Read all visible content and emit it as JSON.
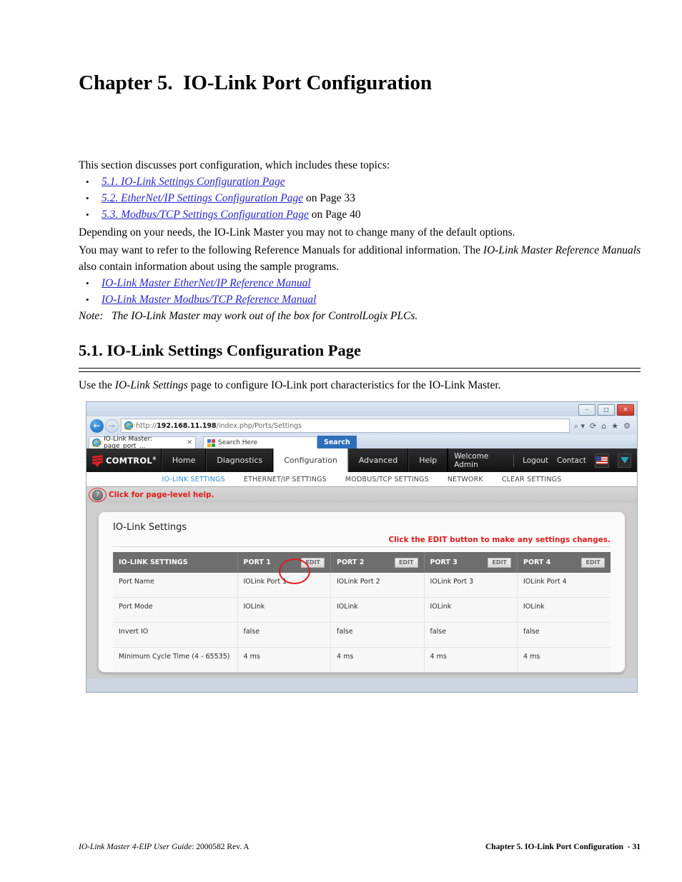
{
  "document": {
    "chapter_title": "Chapter 5.  IO-Link Port Configuration",
    "intro_line": "This section discusses port configuration, which includes these topics:",
    "topics": [
      {
        "link": "5.1. IO-Link Settings Configuration Page",
        "suffix": ""
      },
      {
        "link": "5.2. EtherNet/IP Settings Configuration Page",
        "suffix": " on Page 33"
      },
      {
        "link": "5.3. Modbus/TCP Settings Configuration Page",
        "suffix": " on Page 40"
      }
    ],
    "para_depending": "Depending on your needs, the IO-Link Master you may not to change many of the default options.",
    "para_refer_1": "You may want to refer to the following Reference Manuals for additional information. The ",
    "para_refer_italic": "IO-Link Master Reference Manuals",
    "para_refer_2": " also contain information about using the sample programs.",
    "manuals": [
      "IO-Link Master EtherNet/IP Reference Manual",
      "IO-Link Master Modbus/TCP Reference Manual"
    ],
    "note_label": "Note:",
    "note_text": "The IO-Link Master may work out of the box for ControlLogix PLCs.",
    "section_heading": "5.1. IO-Link Settings Configuration Page",
    "use_line_1": "Use the ",
    "use_line_italic": "IO-Link Settings",
    "use_line_2": " page to configure IO-Link port characteristics for the IO-Link Master.",
    "link_color": "#2626cc"
  },
  "footer": {
    "left_italic": "IO-Link Master 4-EIP User Guide",
    "left_rest": ": 2000582 Rev. A",
    "right": "Chapter 5. IO-Link Port Configuration  - 31"
  },
  "browser": {
    "window_controls": {
      "minimize": "–",
      "maximize": "□",
      "close": "✕"
    },
    "back_glyph": "←",
    "forward_glyph": "→",
    "url_scheme": "http://",
    "url_host": "192.168.11.198",
    "url_path": "/index.php/Ports/Settings",
    "toolbar_icons": {
      "search_dropdown": "⌕ ▾",
      "refresh": "⟳",
      "home": "⌂",
      "favorites": "★",
      "tools": "⚙"
    },
    "tab_title": "IO-Link Master: page_port_...",
    "tab_close": "✕",
    "search_placeholder": "Search Here",
    "search_button": "Search"
  },
  "app": {
    "logo_text": "COMTROL",
    "logo_tm": "®",
    "nav_items": [
      {
        "label": "Home",
        "active": false
      },
      {
        "label": "Diagnostics",
        "active": false
      },
      {
        "label": "Configuration",
        "active": true
      },
      {
        "label": "Advanced",
        "active": false
      },
      {
        "label": "Help",
        "active": false
      }
    ],
    "welcome": "Welcome Admin",
    "logout": "Logout",
    "contact": "Contact",
    "language_flag": "us-flag-icon",
    "subnav": [
      {
        "label": "IO-LINK SETTINGS",
        "selected": true
      },
      {
        "label": "ETHERNET/IP SETTINGS",
        "selected": false
      },
      {
        "label": "MODBUS/TCP SETTINGS",
        "selected": false
      },
      {
        "label": "NETWORK",
        "selected": false
      },
      {
        "label": "CLEAR SETTINGS",
        "selected": false
      }
    ],
    "help_icon_glyph": "?",
    "help_text": "Click for page-level help.",
    "panel_title": "IO-Link Settings",
    "edit_hint": "Click the EDIT button to make any settings changes.",
    "table": {
      "header_label": "IO-LINK SETTINGS",
      "ports": [
        "PORT 1",
        "PORT 2",
        "PORT 3",
        "PORT 4"
      ],
      "edit_label": "EDIT",
      "rows": [
        {
          "label": "Port Name",
          "values": [
            "IOLink Port 1",
            "IOLink Port 2",
            "IOLink Port 3",
            "IOLink Port 4"
          ]
        },
        {
          "label": "Port Mode",
          "values": [
            "IOLink",
            "IOLink",
            "IOLink",
            "IOLink"
          ]
        },
        {
          "label": "Invert IO",
          "values": [
            "false",
            "false",
            "false",
            "false"
          ]
        },
        {
          "label": "Minimum Cycle Time (4 - 65535)",
          "values": [
            "4 ms",
            "4 ms",
            "4 ms",
            "4 ms"
          ]
        }
      ]
    },
    "annotation_color": "#e01b1b"
  }
}
